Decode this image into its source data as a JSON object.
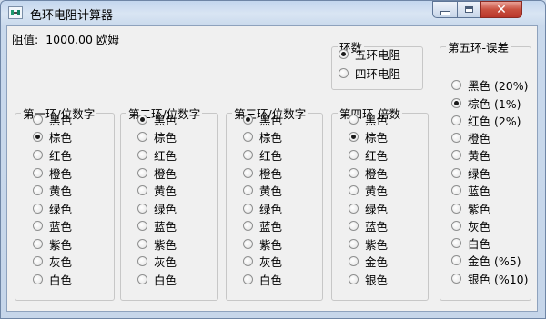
{
  "window": {
    "title": "色环电阻计算器"
  },
  "resistance": {
    "label": "阻值:",
    "value": "1000.00 欧姆"
  },
  "ring_count": {
    "title": "环数",
    "options": [
      "五环电阻",
      "四环电阻"
    ],
    "selected": 0
  },
  "band1": {
    "title": "第一环/位数字",
    "options": [
      "黑色",
      "棕色",
      "红色",
      "橙色",
      "黄色",
      "绿色",
      "蓝色",
      "紫色",
      "灰色",
      "白色"
    ],
    "selected": 1
  },
  "band2": {
    "title": "第二环/位数字",
    "options": [
      "黑色",
      "棕色",
      "红色",
      "橙色",
      "黄色",
      "绿色",
      "蓝色",
      "紫色",
      "灰色",
      "白色"
    ],
    "selected": 0
  },
  "band3": {
    "title": "第三环/位数字",
    "options": [
      "黑色",
      "棕色",
      "红色",
      "橙色",
      "黄色",
      "绿色",
      "蓝色",
      "紫色",
      "灰色",
      "白色"
    ],
    "selected": 0
  },
  "band4": {
    "title": "第四环-倍数",
    "options": [
      "黑色",
      "棕色",
      "红色",
      "橙色",
      "黄色",
      "绿色",
      "蓝色",
      "紫色",
      "金色",
      "银色"
    ],
    "selected": 1
  },
  "band5": {
    "title": "第五环-误差",
    "options": [
      "黑色 (20%)",
      "棕色 (1%)",
      "红色 (2%)",
      "橙色",
      "黄色",
      "绿色",
      "蓝色",
      "紫色",
      "灰色",
      "白色",
      "金色 (%5)",
      "银色 (%10)"
    ],
    "selected": 1
  }
}
